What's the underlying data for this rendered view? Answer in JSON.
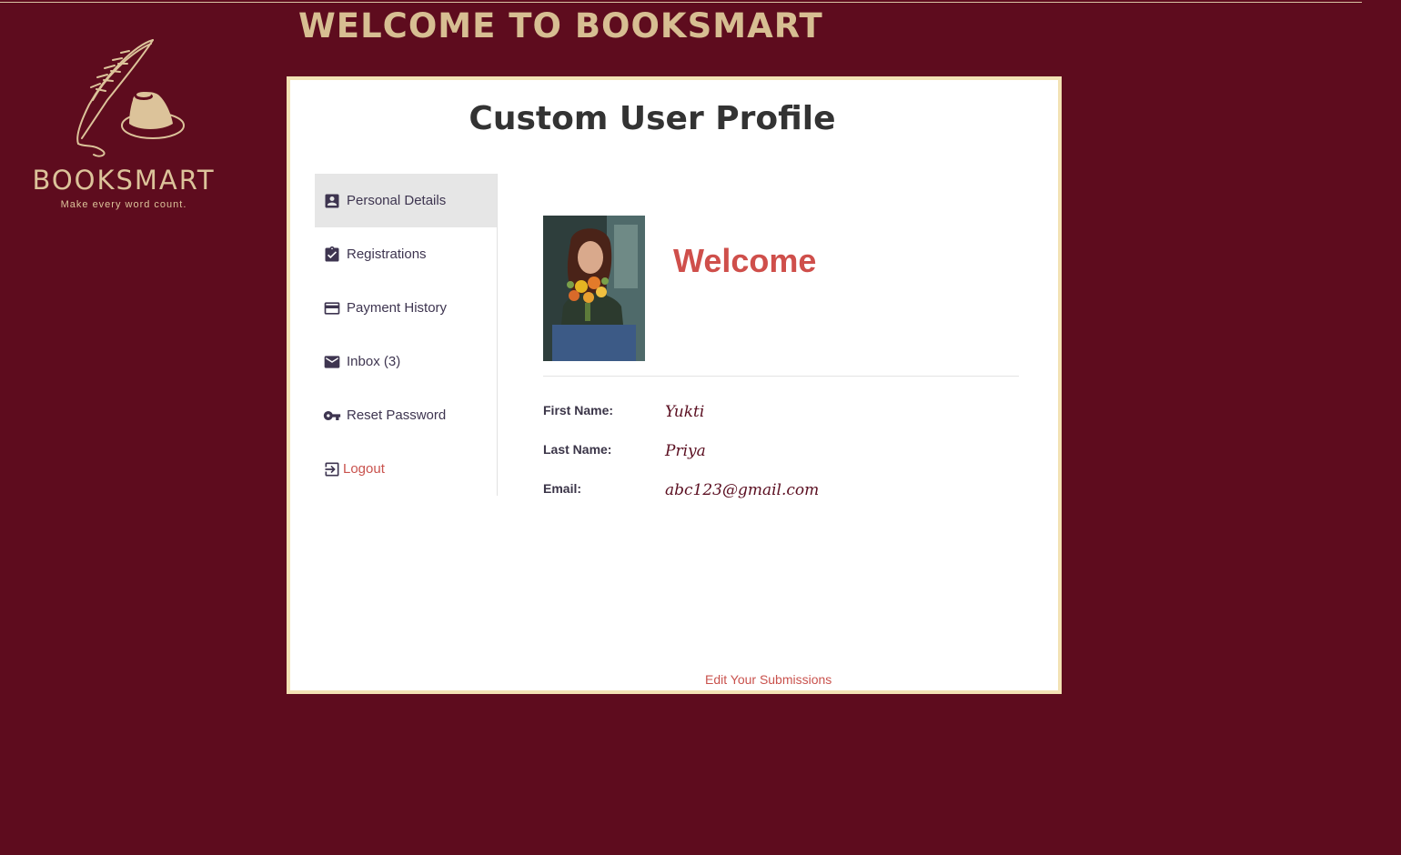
{
  "header": {
    "site_title": "WELCOME TO BOOKSMART"
  },
  "logo": {
    "brand": "BOOKSMART",
    "tagline": "Make every word count.",
    "icon": "quill-and-inkpot-icon"
  },
  "card": {
    "title": "Custom User Profile"
  },
  "sidebar": {
    "items": [
      {
        "label": "Personal Details",
        "icon": "account-box-icon",
        "active": true
      },
      {
        "label": "Registrations",
        "icon": "clipboard-check-icon",
        "active": false
      },
      {
        "label": "Payment History",
        "icon": "credit-card-icon",
        "active": false
      },
      {
        "label": "Inbox (3)",
        "icon": "mail-icon",
        "active": false
      },
      {
        "label": "Reset Password",
        "icon": "key-icon",
        "active": false
      },
      {
        "label": "Logout",
        "icon": "exit-icon",
        "active": false
      }
    ]
  },
  "profile": {
    "greeting": "Welcome",
    "fields": [
      {
        "label": "First Name:",
        "value": "Yukti"
      },
      {
        "label": "Last Name:",
        "value": "Priya"
      },
      {
        "label": "Email:",
        "value": "abc123@gmail.com"
      }
    ],
    "edit_link": "Edit Your Submissions"
  },
  "colors": {
    "background": "#5e0c1e",
    "accent": "#cf4f4b",
    "card_border": "#f3e2b4",
    "title_gold": "#d7be92"
  }
}
